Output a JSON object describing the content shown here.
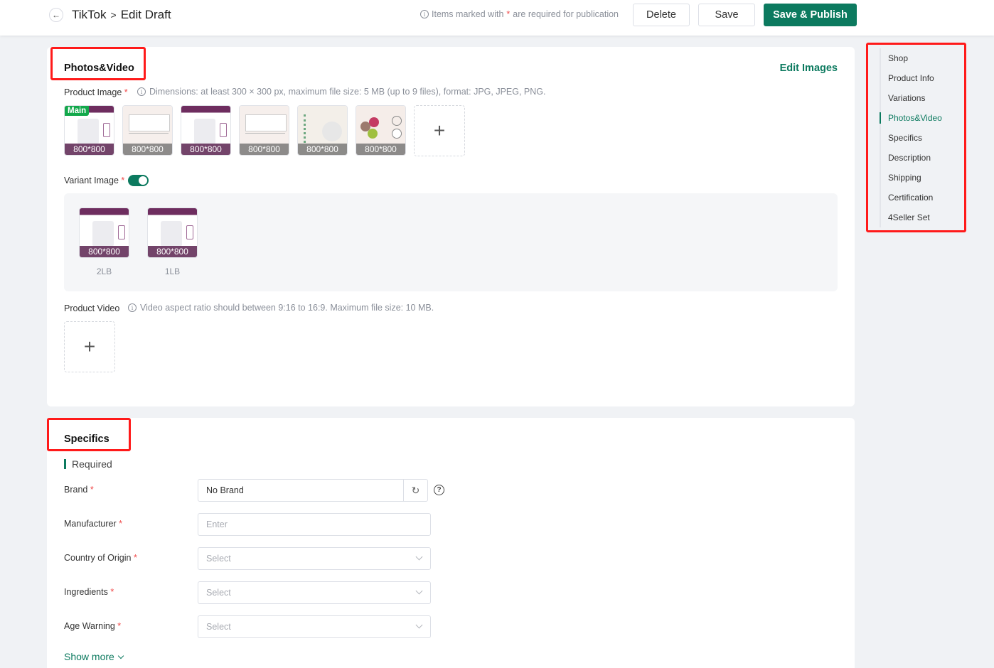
{
  "header": {
    "back_icon": "arrow-left-icon",
    "breadcrumb": [
      "TikTok",
      "Edit Draft"
    ],
    "breadcrumb_separator": ">",
    "required_note_prefix": "Items marked with",
    "required_note_star": "*",
    "required_note_suffix": "are required for publication",
    "buttons": {
      "delete": "Delete",
      "save": "Save",
      "publish": "Save & Publish"
    }
  },
  "colors": {
    "accent": "#0c7a5f",
    "required_star": "#f04a4a",
    "highlight_box": "#ff1a1a",
    "main_tag": "#12a84b"
  },
  "photos_video": {
    "title": "Photos&Video",
    "edit_images": "Edit Images",
    "product_image_label": "Product Image",
    "product_image_hint": "Dimensions: at least 300 × 300 px, maximum file size: 5 MB (up to 9 files), format: JPG, JPEG, PNG.",
    "main_tag": "Main",
    "images": [
      {
        "dimension": "800*800",
        "style": "purple"
      },
      {
        "dimension": "800*800",
        "style": "sheet"
      },
      {
        "dimension": "800*800",
        "style": "purple"
      },
      {
        "dimension": "800*800",
        "style": "sheet"
      },
      {
        "dimension": "800*800",
        "style": "powder"
      },
      {
        "dimension": "800*800",
        "style": "pills"
      }
    ],
    "add_icon": "+",
    "variant_image_label": "Variant Image",
    "variant_image_enabled": true,
    "variants": [
      {
        "dimension": "800*800",
        "label": "2LB"
      },
      {
        "dimension": "800*800",
        "label": "1LB"
      }
    ],
    "product_video_label": "Product Video",
    "product_video_hint": "Video aspect ratio should between 9:16 to 16:9. Maximum file size: 10 MB."
  },
  "specifics": {
    "title": "Specifics",
    "required_heading": "Required",
    "fields": [
      {
        "label": "Brand",
        "value": "No Brand",
        "type": "brand"
      },
      {
        "label": "Manufacturer",
        "placeholder": "Enter",
        "type": "input"
      },
      {
        "label": "Country of Origin",
        "placeholder": "Select",
        "type": "select"
      },
      {
        "label": "Ingredients",
        "placeholder": "Select",
        "type": "select"
      },
      {
        "label": "Age Warning",
        "placeholder": "Select",
        "type": "select"
      }
    ],
    "show_more": "Show more"
  },
  "side_nav": {
    "items": [
      "Shop",
      "Product Info",
      "Variations",
      "Photos&Video",
      "Specifics",
      "Description",
      "Shipping",
      "Certification",
      "4Seller Set"
    ],
    "active": "Photos&Video"
  }
}
